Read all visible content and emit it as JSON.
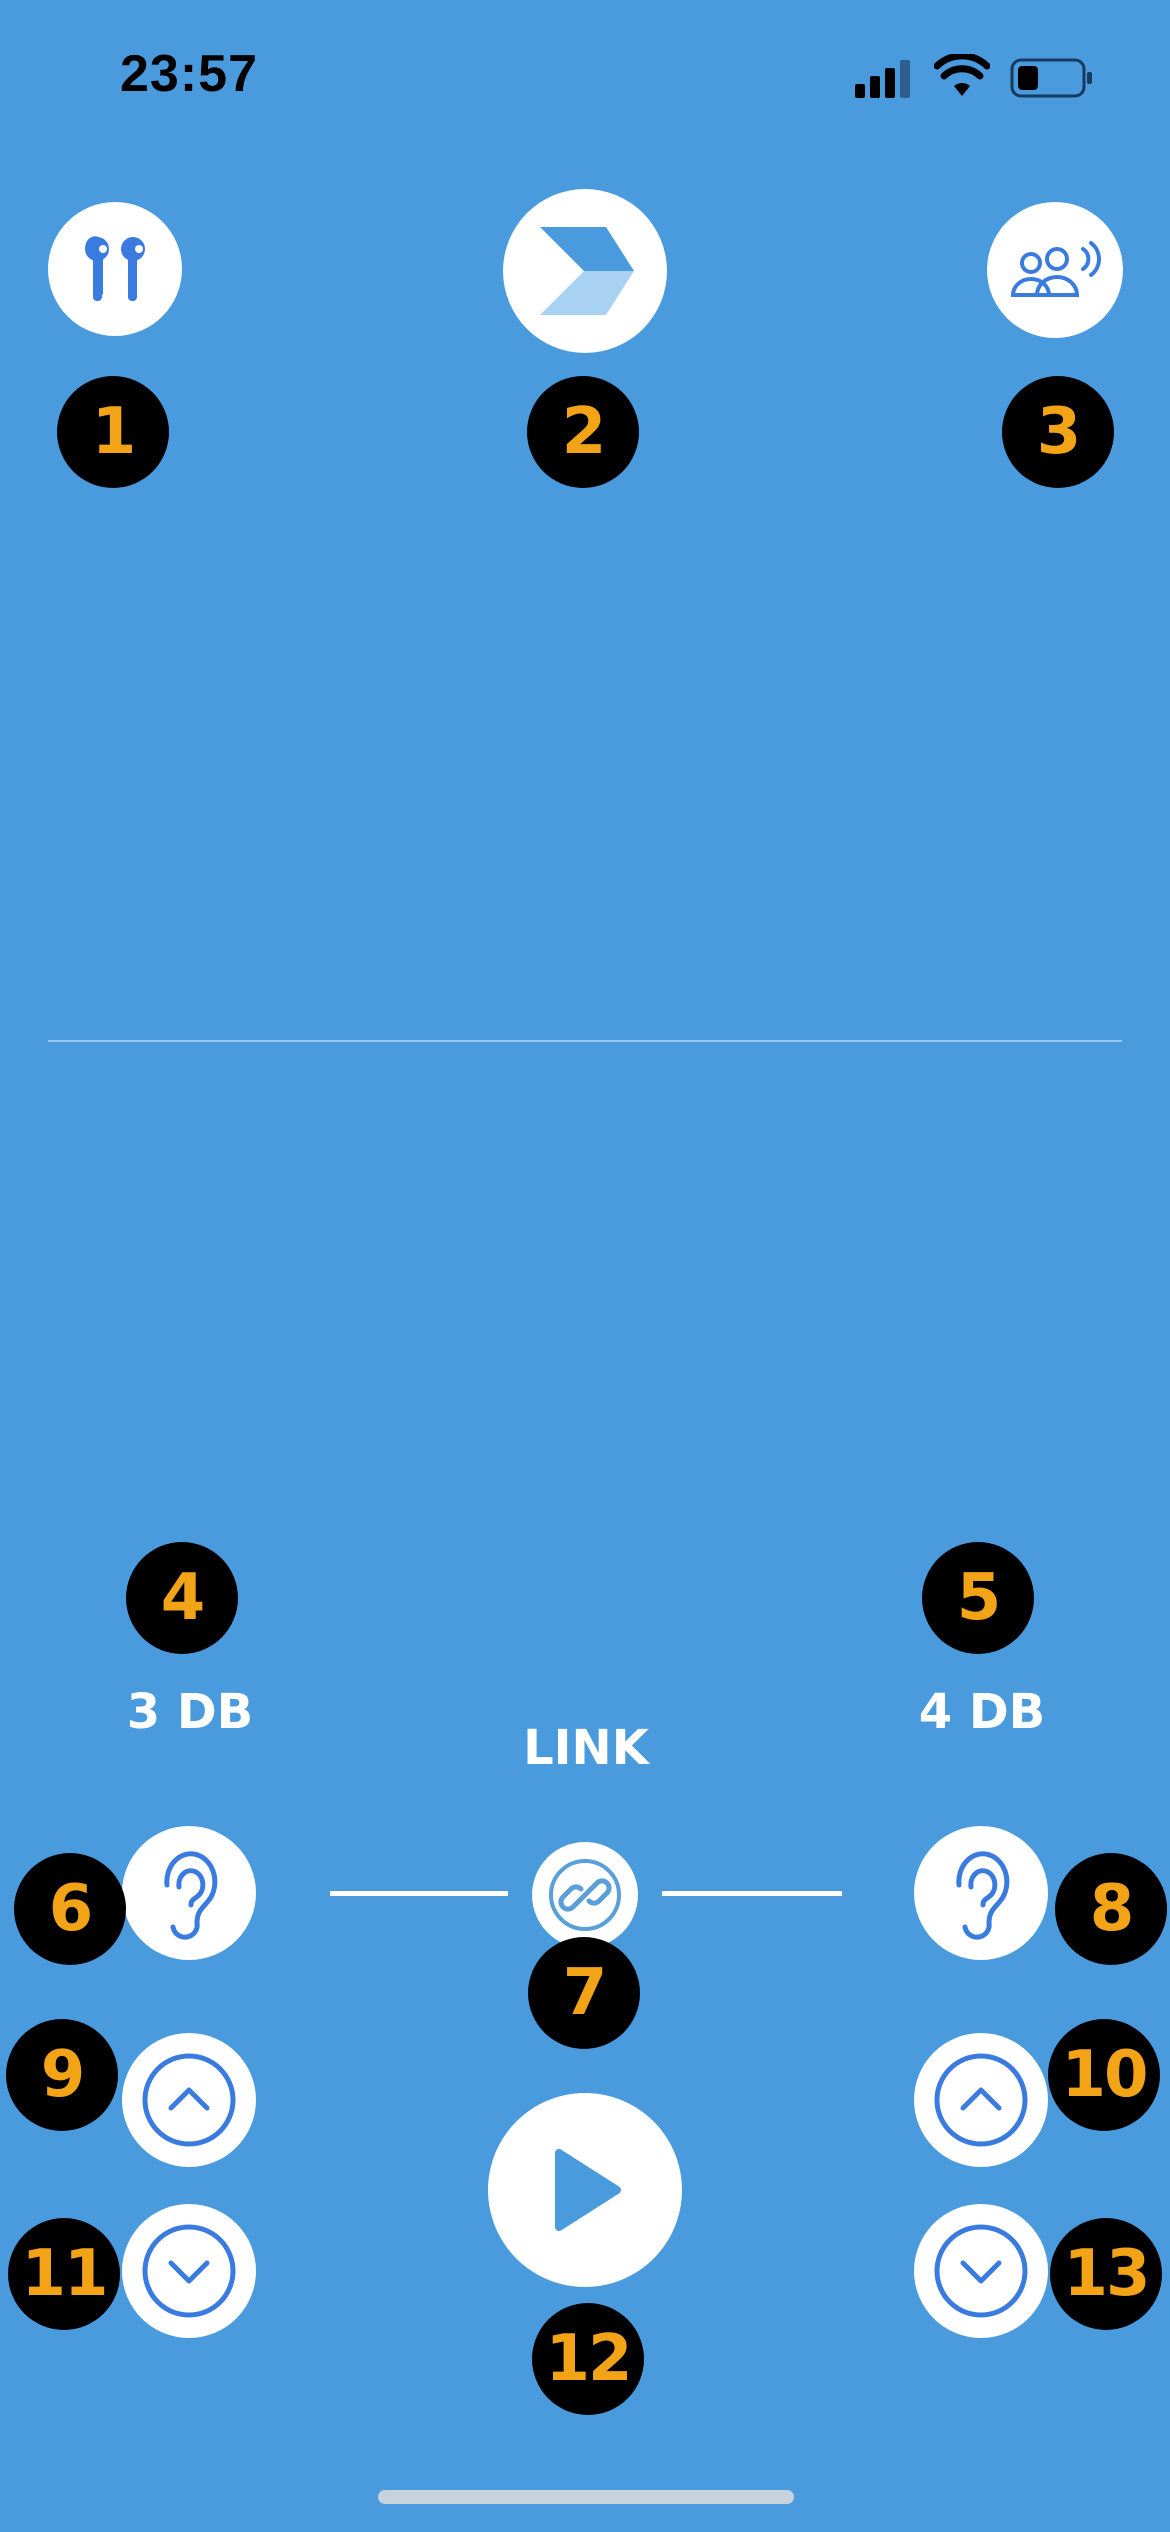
{
  "status_bar": {
    "time": "23:57"
  },
  "top_buttons": [
    {
      "name": "airpods-button",
      "icon": "airpods-icon",
      "badge": "1"
    },
    {
      "name": "app-logo-button",
      "icon": "chevron-logo-icon",
      "badge": "2"
    },
    {
      "name": "group-audio-button",
      "icon": "people-sound-icon",
      "badge": "3"
    }
  ],
  "left": {
    "badge_db": "4",
    "db_label": "3 DB",
    "ear_badge": "6",
    "up_badge": "9",
    "down_badge": "11"
  },
  "right": {
    "badge_db": "5",
    "db_label": "4 DB",
    "ear_badge": "8",
    "up_badge": "10",
    "down_badge": "13"
  },
  "center": {
    "link_label": "LINK",
    "link_badge": "7",
    "play_badge": "12"
  },
  "colors": {
    "background": "#4A9BDD",
    "accent": "#3A7BE0",
    "badge_bg": "#000000",
    "badge_text": "#F2A316"
  }
}
